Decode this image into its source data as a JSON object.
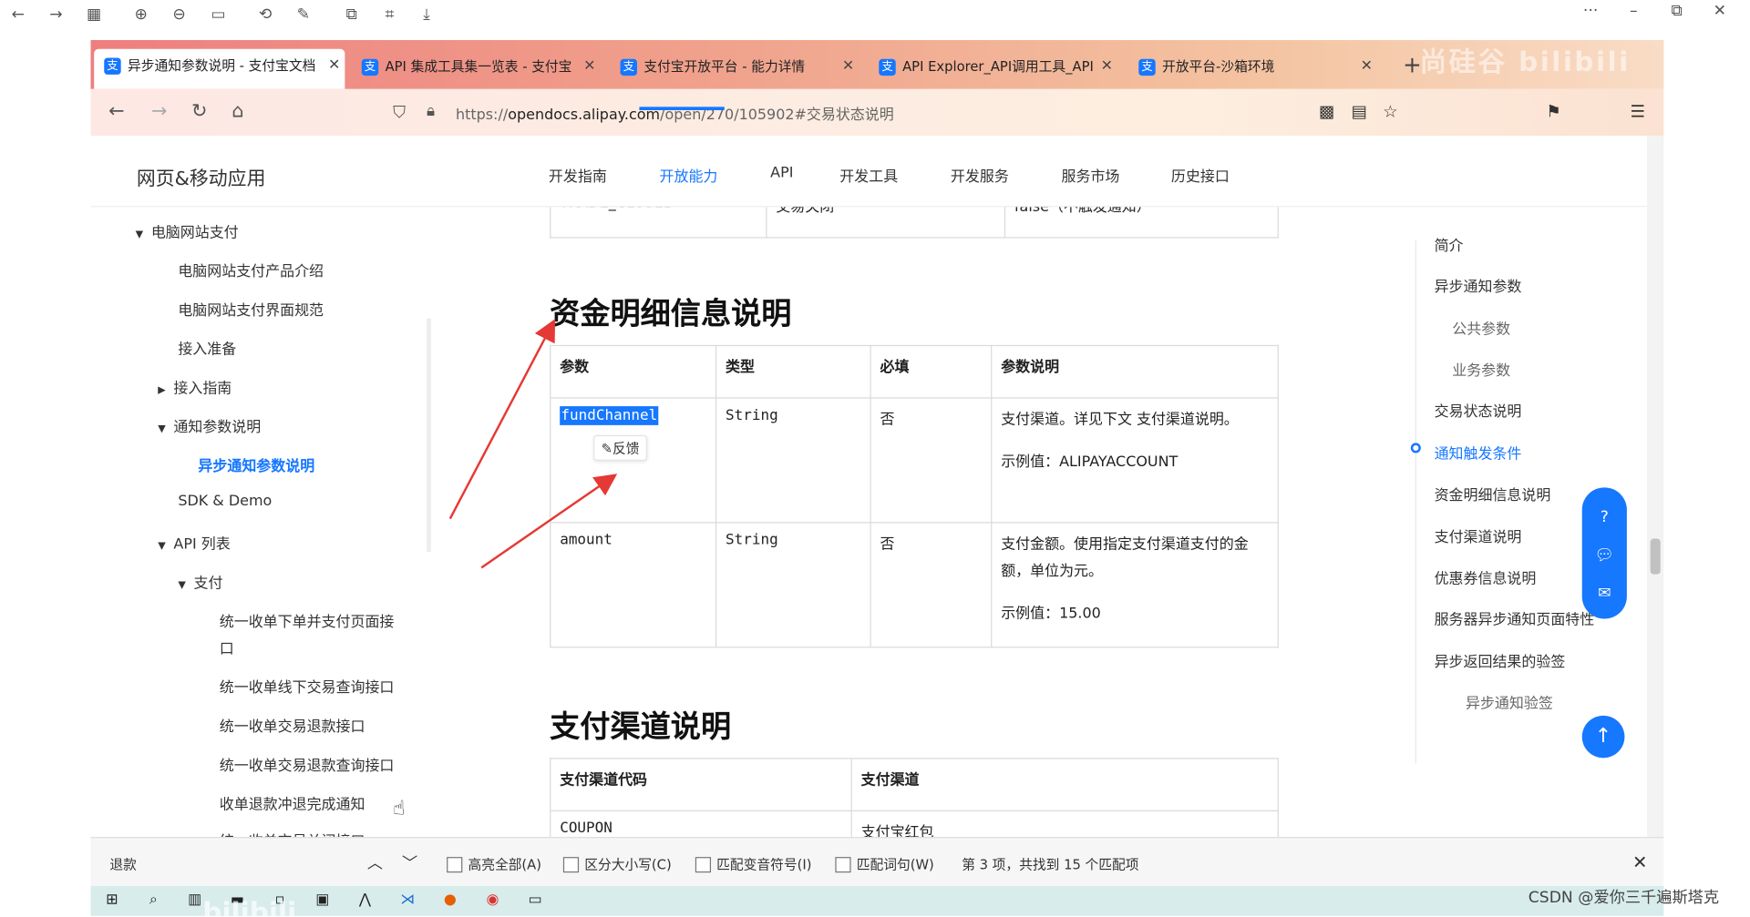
{
  "viewer": {
    "more": "···",
    "minimize": "–",
    "restore": "⧉",
    "close": "✕"
  },
  "tabs": [
    {
      "title": "异步通知参数说明 - 支付宝文档",
      "close": "✕",
      "active": true
    },
    {
      "title": "API 集成工具集一览表 - 支付宝",
      "close": "✕",
      "active": false
    },
    {
      "title": "支付宝开放平台 - 能力详情",
      "close": "✕",
      "active": false
    },
    {
      "title": "API Explorer_API调用工具_API",
      "close": "✕",
      "active": false
    },
    {
      "title": "开放平台-沙箱环境",
      "close": "✕",
      "active": false
    }
  ],
  "new_tab": "+",
  "address": {
    "url_prefix": "https://",
    "url_host": "opendocs.alipay.com",
    "url_path": "/open/270/105902#交易状态说明"
  },
  "watermark": "尚硅谷 bilibili",
  "header": {
    "brand": "网页&移动应用",
    "nav": [
      "开发指南",
      "开放能力",
      "API",
      "开发工具",
      "开发服务",
      "服务市场",
      "历史接口"
    ],
    "nav_selected": "开放能力"
  },
  "sidebar": {
    "items": [
      {
        "label": "电脑网站支付",
        "caret": "▼"
      },
      {
        "label": "电脑网站支付产品介绍",
        "caret": ""
      },
      {
        "label": "电脑网站支付界面规范",
        "caret": ""
      },
      {
        "label": "接入准备",
        "caret": ""
      },
      {
        "label": "接入指南",
        "caret": "▶"
      },
      {
        "label": "通知参数说明",
        "caret": "▼"
      },
      {
        "label": "异步通知参数说明",
        "caret": ""
      },
      {
        "label": "SDK & Demo",
        "caret": ""
      },
      {
        "label": "API 列表",
        "caret": "▼"
      },
      {
        "label": "支付",
        "caret": "▼"
      },
      {
        "label": "统一收单下单并支付页面接",
        "caret": ""
      },
      {
        "label": "口",
        "caret": ""
      },
      {
        "label": "统一收单线下交易查询接口",
        "caret": ""
      },
      {
        "label": "统一收单交易退款接口",
        "caret": ""
      },
      {
        "label": "统一收单交易退款查询接口",
        "caret": ""
      },
      {
        "label": "收单退款冲退完成通知",
        "caret": ""
      },
      {
        "label": "统一收单交易关闭接口",
        "caret": ""
      }
    ]
  },
  "content": {
    "top_row": [
      "TRADE_CLOSED",
      "交易关闭",
      "false（不触发通知）"
    ],
    "section1": {
      "title": "资金明细信息说明",
      "headers": [
        "参数",
        "类型",
        "必填",
        "参数说明"
      ],
      "rows": [
        {
          "param": "fundChannel",
          "type": "String",
          "required": "否",
          "desc": "支付渠道。详见下文 支付渠道说明。",
          "example": "示例值：ALIPAYACCOUNT"
        },
        {
          "param": "amount",
          "type": "String",
          "required": "否",
          "desc": "支付金额。使用指定支付渠道支付的金额，单位为元。",
          "example": "示例值：15.00"
        }
      ],
      "feedback": "反馈"
    },
    "section2": {
      "title": "支付渠道说明",
      "headers": [
        "支付渠道代码",
        "支付渠道"
      ],
      "rows": [
        [
          "COUPON",
          "支付宝红包"
        ]
      ]
    }
  },
  "toc": {
    "items": [
      {
        "label": "简介",
        "level": 1
      },
      {
        "label": "异步通知参数",
        "level": 1
      },
      {
        "label": "公共参数",
        "level": 2
      },
      {
        "label": "业务参数",
        "level": 2
      },
      {
        "label": "交易状态说明",
        "level": 1
      },
      {
        "label": "通知触发条件",
        "level": 1
      },
      {
        "label": "资金明细信息说明",
        "level": 1
      },
      {
        "label": "支付渠道说明",
        "level": 1
      },
      {
        "label": "优惠券信息说明",
        "level": 1
      },
      {
        "label": "服务器异步通知页面特性",
        "level": 1
      },
      {
        "label": "异步返回结果的验签",
        "level": 1
      },
      {
        "label": "异步通知验签",
        "level": 2
      }
    ],
    "selected": "通知触发条件"
  },
  "findbar": {
    "query": "退款",
    "options": [
      "高亮全部(A)",
      "区分大小写(C)",
      "匹配变音符号(I)",
      "匹配词句(W)"
    ],
    "result": "第 3 项，共找到 15 个匹配项",
    "close": "✕"
  },
  "footer": {
    "credit": "CSDN @爱你三千遍斯塔克",
    "taskbar_watermark": "bilibili"
  },
  "colors": {
    "accent": "#1677ff",
    "annotation_arrow": "#e53935"
  }
}
